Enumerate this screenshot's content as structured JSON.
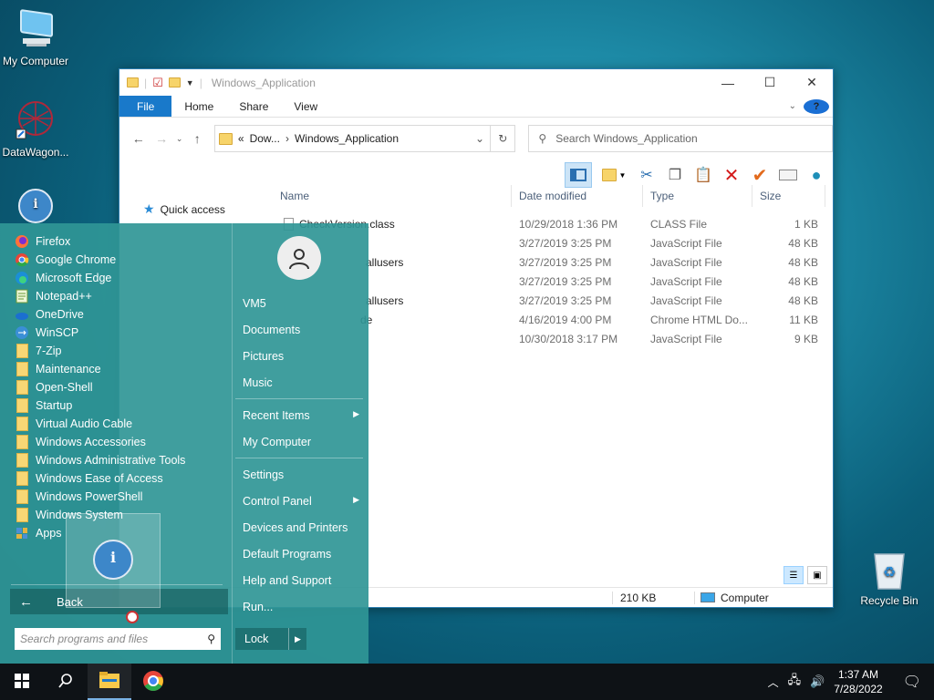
{
  "desktop": {
    "icons": [
      {
        "label": "My Computer",
        "icon": "monitor-icon"
      },
      {
        "label": "DataWagon...",
        "icon": "datawagon-icon"
      },
      {
        "label": "",
        "icon": "info-icon"
      },
      {
        "label": "Recycle Bin",
        "icon": "recycle-bin-icon"
      }
    ]
  },
  "explorer": {
    "title": "Windows_Application",
    "ribbon_tabs": [
      "File",
      "Home",
      "Share",
      "View"
    ],
    "address": {
      "prefix": "«",
      "crumb1": "Dow...",
      "sep": "›",
      "crumb2": "Windows_Application"
    },
    "search_placeholder": "Search Windows_Application",
    "nav": {
      "quick_access": "Quick access"
    },
    "columns": {
      "name": "Name",
      "date": "Date modified",
      "type": "Type",
      "size": "Size"
    },
    "files": [
      {
        "name": "CheckVersion.class",
        "date": "10/29/2018 1:36 PM",
        "type": "CLASS File",
        "size": "1 KB"
      },
      {
        "name": "",
        "date": "3/27/2019 3:25 PM",
        "type": "JavaScript File",
        "size": "48 KB"
      },
      {
        "name": "allusers",
        "date": "3/27/2019 3:25 PM",
        "type": "JavaScript File",
        "size": "48 KB"
      },
      {
        "name": "",
        "date": "3/27/2019 3:25 PM",
        "type": "JavaScript File",
        "size": "48 KB"
      },
      {
        "name": "allusers",
        "date": "3/27/2019 3:25 PM",
        "type": "JavaScript File",
        "size": "48 KB"
      },
      {
        "name": "de",
        "date": "4/16/2019 4:00 PM",
        "type": "Chrome HTML Do...",
        "size": "11 KB"
      },
      {
        "name": "",
        "date": "10/30/2018 3:17 PM",
        "type": "JavaScript File",
        "size": "9 KB"
      }
    ],
    "status": {
      "size": "210 KB",
      "location": "Computer"
    }
  },
  "start_menu": {
    "programs": [
      {
        "label": "Firefox",
        "icon": "firefox-icon"
      },
      {
        "label": "Google Chrome",
        "icon": "chrome-icon"
      },
      {
        "label": "Microsoft Edge",
        "icon": "edge-icon"
      },
      {
        "label": "Notepad++",
        "icon": "notepadpp-icon"
      },
      {
        "label": "OneDrive",
        "icon": "onedrive-icon"
      },
      {
        "label": "WinSCP",
        "icon": "winscp-icon"
      },
      {
        "label": "7-Zip",
        "icon": "folder-icon"
      },
      {
        "label": "Maintenance",
        "icon": "folder-icon"
      },
      {
        "label": "Open-Shell",
        "icon": "folder-icon"
      },
      {
        "label": "Startup",
        "icon": "folder-icon"
      },
      {
        "label": "Virtual Audio Cable",
        "icon": "folder-icon"
      },
      {
        "label": "Windows Accessories",
        "icon": "folder-icon"
      },
      {
        "label": "Windows Administrative Tools",
        "icon": "folder-icon"
      },
      {
        "label": "Windows Ease of Access",
        "icon": "folder-icon"
      },
      {
        "label": "Windows PowerShell",
        "icon": "folder-icon"
      },
      {
        "label": "Windows System",
        "icon": "folder-icon"
      },
      {
        "label": "Apps",
        "icon": "apps-icon"
      }
    ],
    "back_label": "Back",
    "search_placeholder": "Search programs and files",
    "right": {
      "user": "VM5",
      "documents": "Documents",
      "pictures": "Pictures",
      "music": "Music",
      "recent": "Recent Items",
      "computer": "My Computer",
      "settings": "Settings",
      "control_panel": "Control Panel",
      "devices": "Devices and Printers",
      "defaults": "Default Programs",
      "help": "Help and Support",
      "run": "Run..."
    },
    "lock_label": "Lock"
  },
  "taskbar": {
    "time": "1:37 AM",
    "date": "7/28/2022"
  },
  "colors": {
    "start_bg": "#3096a0",
    "accent": "#1979ca",
    "taskbar": "#0e1216"
  }
}
